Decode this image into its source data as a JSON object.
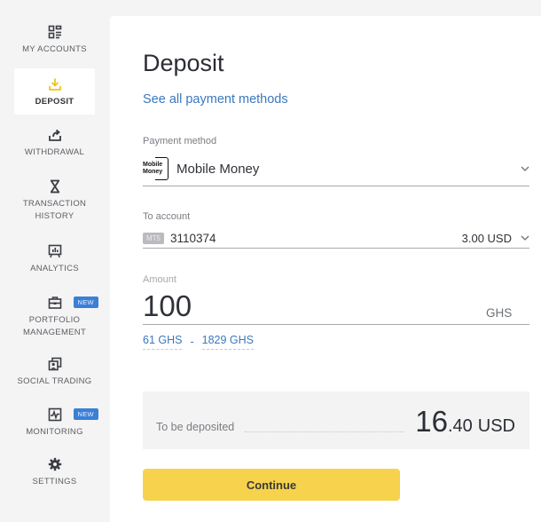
{
  "sidebar": {
    "items": [
      {
        "label": "MY ACCOUNTS",
        "icon": "accounts-grid-icon",
        "active": false
      },
      {
        "label": "DEPOSIT",
        "icon": "deposit-download-icon",
        "active": true
      },
      {
        "label": "WITHDRAWAL",
        "icon": "withdrawal-upload-icon",
        "active": false
      },
      {
        "label": "TRANSACTION HISTORY",
        "icon": "hourglass-icon",
        "active": false
      },
      {
        "label": "ANALYTICS",
        "icon": "analytics-board-icon",
        "active": false
      },
      {
        "label": "PORTFOLIO MANAGEMENT",
        "icon": "briefcase-icon",
        "active": false,
        "badge": "NEW"
      },
      {
        "label": "SOCIAL TRADING",
        "icon": "social-trading-icon",
        "active": false
      },
      {
        "label": "MONITORING",
        "icon": "monitoring-chart-icon",
        "active": false,
        "badge": "NEW"
      },
      {
        "label": "SETTINGS",
        "icon": "gear-icon",
        "active": false
      }
    ],
    "accent_color": "#f0c419",
    "badge_color": "#3b7fd6"
  },
  "main": {
    "title": "Deposit",
    "all_methods_link": "See all payment methods",
    "payment_method": {
      "label": "Payment method",
      "logo_text_line1": "Mobile",
      "logo_text_line2": "Money",
      "value": "Mobile Money"
    },
    "to_account": {
      "label": "To account",
      "platform_tag": "MT5",
      "account_number": "3110374",
      "balance": "3.00 USD"
    },
    "amount": {
      "label": "Amount",
      "value": "100",
      "currency": "GHS",
      "min": "61 GHS",
      "separator": "-",
      "max": "1829 GHS"
    },
    "summary": {
      "label": "To be deposited",
      "amount_int": "16",
      "amount_dec": ".40",
      "currency": "USD"
    },
    "continue_label": "Continue",
    "link_color": "#3a78bf",
    "button_color": "#f7d24d"
  }
}
